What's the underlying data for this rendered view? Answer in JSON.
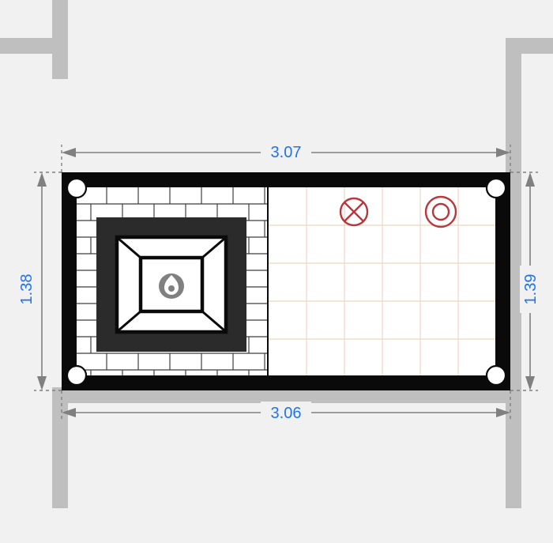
{
  "dimensions": {
    "top_width": "3.07",
    "bottom_width": "3.06",
    "left_height": "1.38",
    "right_height": "1.39"
  },
  "symbols": {
    "fireplace": "fireplace-icon",
    "ceiling_light_x": "ceiling-light-x-icon",
    "ceiling_light_o": "ceiling-light-o-icon"
  },
  "surfaces": {
    "left": "brick",
    "right": "tile"
  }
}
